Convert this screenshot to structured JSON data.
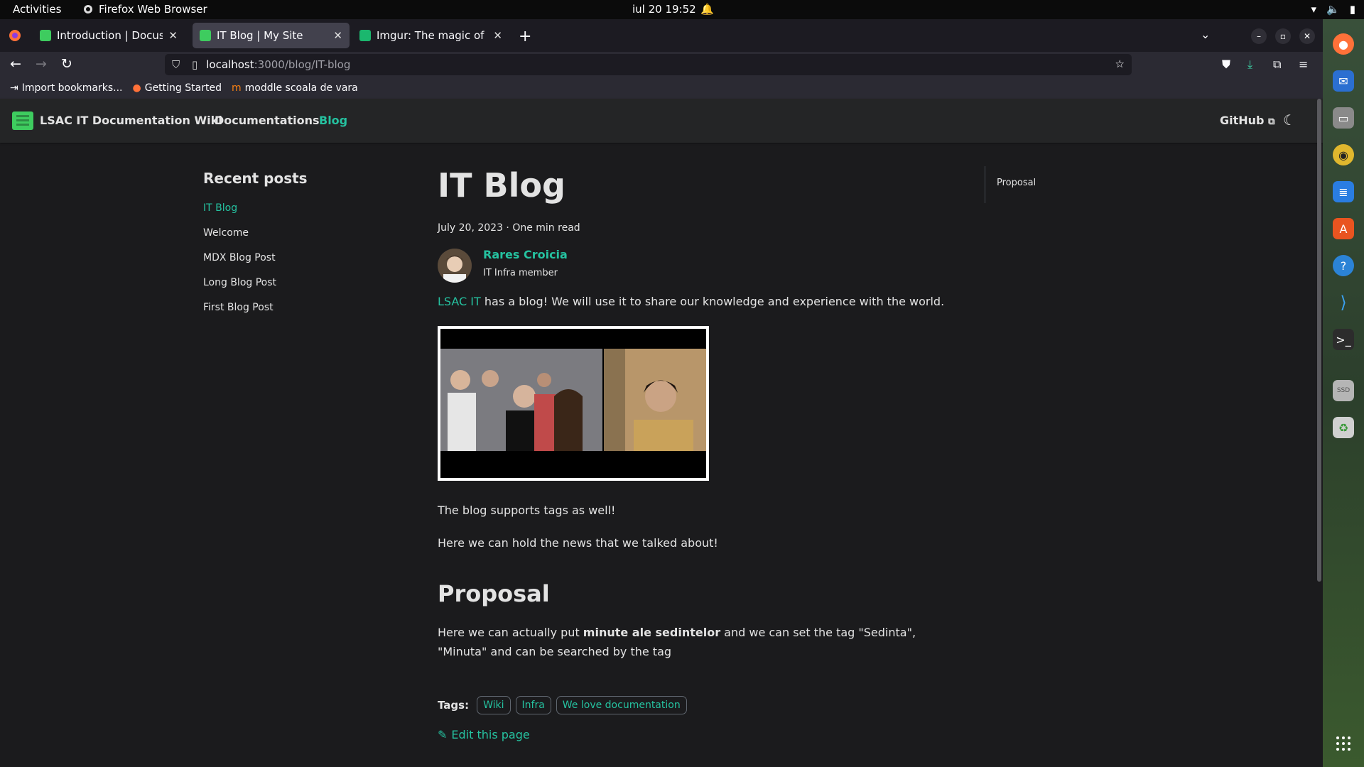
{
  "system": {
    "activities": "Activities",
    "app_name": "Firefox Web Browser",
    "clock": "iul 20  19:52"
  },
  "browser": {
    "tabs": [
      {
        "title": "Introduction | Docusaurus",
        "active": false
      },
      {
        "title": "IT Blog | My Site",
        "active": true
      },
      {
        "title": "Imgur: The magic of the Internet",
        "active": false
      }
    ],
    "url_host": "localhost",
    "url_path": ":3000/blog/IT-blog",
    "bookmarks": [
      "Import bookmarks...",
      "Getting Started",
      "moddle scoala de vara"
    ]
  },
  "site": {
    "brand": "LSAC IT Documentation Wiki",
    "nav": {
      "docs": "Documentations",
      "blog": "Blog",
      "github": "GitHub"
    },
    "sidebar": {
      "title": "Recent posts",
      "items": [
        "IT Blog",
        "Welcome",
        "MDX Blog Post",
        "Long Blog Post",
        "First Blog Post"
      ]
    },
    "post": {
      "title": "IT Blog",
      "meta": "July 20, 2023 · One min read",
      "author": "Rares Croicia",
      "author_role": "IT Infra member",
      "intro_link": "LSAC IT",
      "intro_rest": " has a blog! We will use it to share our knowledge and experience with the world.",
      "p1": "The blog supports tags as well!",
      "p2": "Here we can hold the news that we talked about!",
      "h2": "Proposal",
      "p3_a": "Here we can actually put ",
      "p3_bold": "minute ale sedintelor",
      "p3_b": " and we can set the tag \"Sedinta\", \"Minuta\" and can be searched by the tag",
      "tags_label": "Tags:",
      "tags": [
        "Wiki",
        "Infra",
        "We love documentation"
      ],
      "edit": "Edit this page"
    },
    "toc": [
      "Proposal"
    ]
  },
  "colors": {
    "accent": "#25c2a0",
    "background": "#1b1b1d",
    "navbar": "#242526"
  }
}
